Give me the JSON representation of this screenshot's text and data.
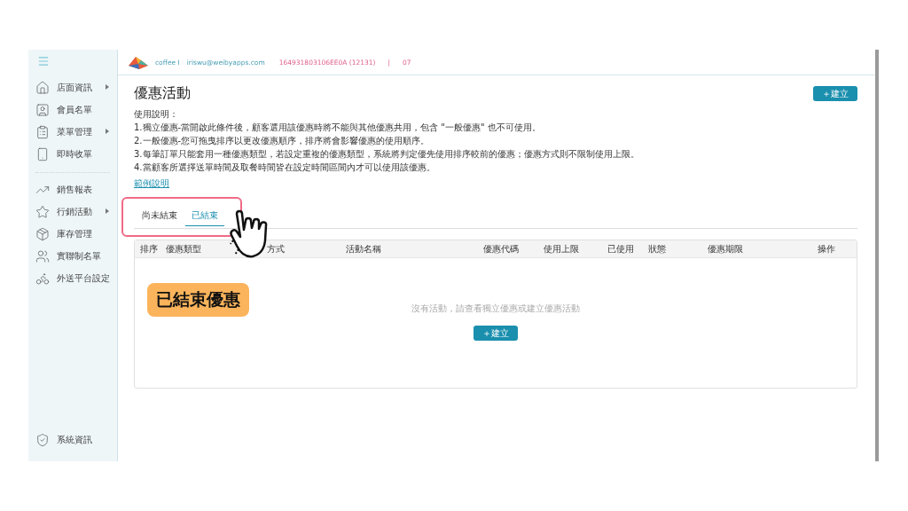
{
  "sidebar": {
    "items": [
      {
        "label": "店面資訊",
        "has_submenu": true
      },
      {
        "label": "會員名單",
        "has_submenu": false
      },
      {
        "label": "菜單管理",
        "has_submenu": true
      },
      {
        "label": "即時收單",
        "has_submenu": false
      },
      {
        "label": "銷售報表",
        "has_submenu": false
      },
      {
        "label": "行銷活動",
        "has_submenu": true
      },
      {
        "label": "庫存管理",
        "has_submenu": false
      },
      {
        "label": "實聯制名單",
        "has_submenu": false
      },
      {
        "label": "外送平台設定",
        "has_submenu": false
      }
    ],
    "footer_items": [
      {
        "label": "系統資訊"
      }
    ]
  },
  "header": {
    "store": "coffee I",
    "email": "iriswu@weibyapps.com",
    "device_id": "164931803106EE0A (12131)",
    "separator": "|",
    "code": "07"
  },
  "page": {
    "title": "優惠活動",
    "create_button": "＋建立",
    "instructions_title": "使用說明：",
    "instructions": [
      "1.獨立優惠-當開啟此條件後，顧客選用該優惠時將不能與其他優惠共用，包含 \"一般優惠\" 也不可使用。",
      "2.一般優惠-您可拖曳排序以更改優惠順序，排序將會影響優惠的使用順序。",
      "3.每筆訂單只能套用一種優惠類型，若設定重複的優惠類型，系統將判定優先使用排序較前的優惠；優惠方式則不限制使用上限。",
      "4.當顧客所選擇送單時間及取餐時間皆在設定時間區間內才可以使用該優惠。"
    ],
    "example_link": "範例說明",
    "tabs": [
      {
        "label": "尚未結束",
        "selected": false
      },
      {
        "label": "已結束",
        "selected": true
      }
    ],
    "table": {
      "columns": [
        "排序",
        "優惠類型",
        "方式",
        "活動名稱",
        "優惠代碼",
        "使用上限",
        "已使用",
        "狀態",
        "優惠期限",
        "操作"
      ],
      "empty_message": "沒有活動，請查看獨立優惠或建立優惠活動",
      "empty_button": "＋建立"
    }
  },
  "annotation": {
    "label": "已結束優惠"
  }
}
